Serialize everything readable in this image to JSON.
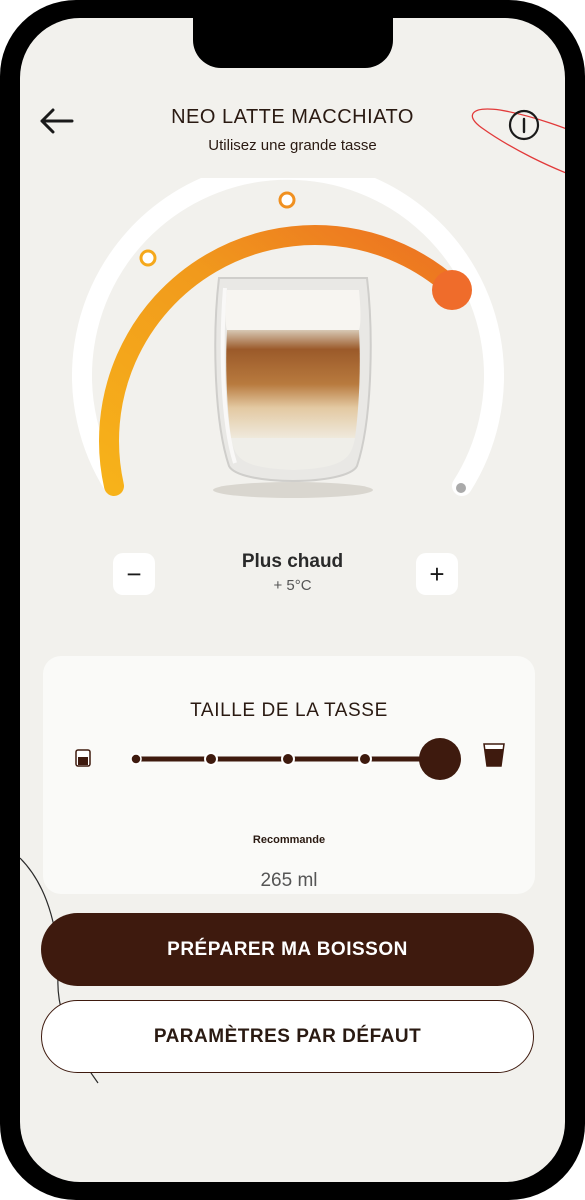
{
  "header": {
    "title": "NEO LATTE MACCHIATO",
    "subtitle": "Utilisez une grande tasse"
  },
  "icons": {
    "back": "back-arrow-icon",
    "info": "info-icon"
  },
  "temperature": {
    "label": "Plus chaud",
    "value": "+ 5°C",
    "decrease_label": "−",
    "increase_label": "+",
    "level_fraction": 0.82
  },
  "cup_size": {
    "title": "TAILLE DE LA TASSE",
    "recommendation": "Recommande",
    "volume": "265 ml",
    "steps": 5,
    "selected_step": 5
  },
  "actions": {
    "primary_label": "PRÉPARER MA BOISSON",
    "secondary_label": "PARAMÈTRES PAR DÉFAUT"
  },
  "colors": {
    "background": "#f2f1ed",
    "brand_brown": "#3e1a0e",
    "dial_start": "#f6ad1a",
    "dial_end": "#ee7b1f",
    "knob": "#ef6c2b",
    "deco_red": "#e23a3a"
  }
}
